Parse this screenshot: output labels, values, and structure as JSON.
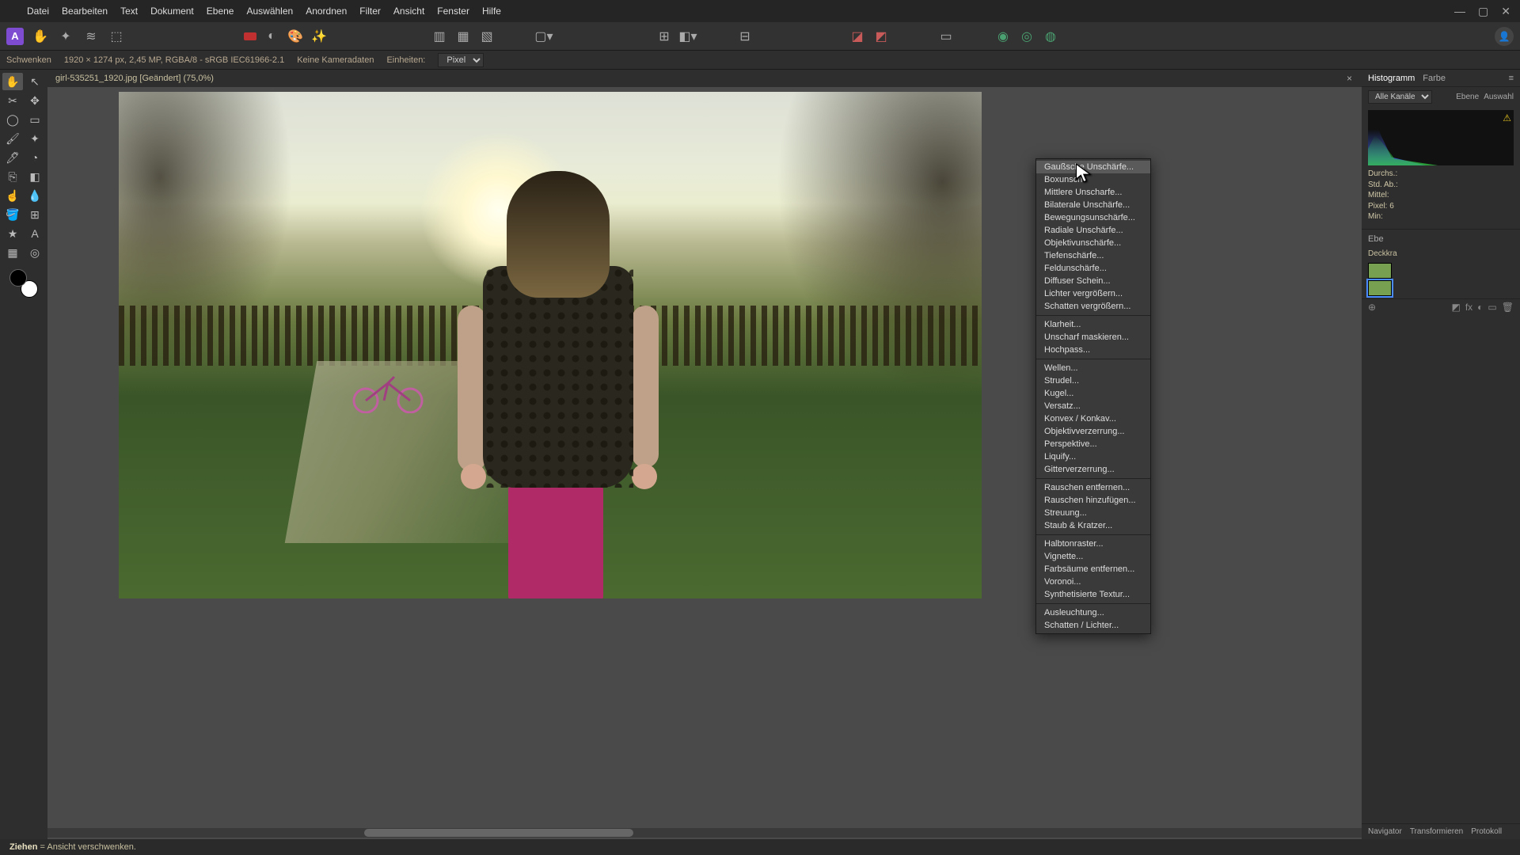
{
  "menu": [
    "Datei",
    "Bearbeiten",
    "Text",
    "Dokument",
    "Ebene",
    "Auswählen",
    "Anordnen",
    "Filter",
    "Ansicht",
    "Fenster",
    "Hilfe"
  ],
  "contextbar": {
    "tool": "Schwenken",
    "docinfo": "1920 × 1274 px, 2,45 MP, RGBA/8 - sRGB IEC61966-2.1",
    "camera": "Keine Kameradaten",
    "units_label": "Einheiten:",
    "units_value": "Pixel"
  },
  "doc_tab": "girl-535251_1920.jpg [Geändert] (75,0%)",
  "rightpanel": {
    "tabs": [
      "Histogramm",
      "Farbe"
    ],
    "channel": "Alle Kanäle",
    "btn_layer": "Ebene",
    "btn_sel": "Auswahl",
    "stats": {
      "l1": "Durchs.:",
      "l2": "Std. Ab.:",
      "l3": "Mittel:",
      "l4": "Pixel: 6",
      "l5": "Min:"
    },
    "layers_tabs": "Ebe",
    "opacity_label": "Deckkra",
    "bottom_tabs": [
      "Navigator",
      "Transformieren",
      "Protokoll"
    ]
  },
  "filter_menu": {
    "groups": [
      [
        "Gaußsche Unschärfe...",
        "Boxunsch",
        "Mittlere Unscharfe...",
        "Bilaterale Unschärfe...",
        "Bewegungsunschärfe...",
        "Radiale Unschärfe...",
        "Objektivunschärfe...",
        "Tiefenschärfe...",
        "Feldunschärfe...",
        "Diffuser Schein...",
        "Lichter vergrößern...",
        "Schatten vergrößern..."
      ],
      [
        "Klarheit...",
        "Unscharf maskieren...",
        "Hochpass..."
      ],
      [
        "Wellen...",
        "Strudel...",
        "Kugel...",
        "Versatz...",
        "Konvex / Konkav...",
        "Objektivverzerrung...",
        "Perspektive...",
        "Liquify...",
        "Gitterverzerrung..."
      ],
      [
        "Rauschen entfernen...",
        "Rauschen hinzufügen...",
        "Streuung...",
        "Staub & Kratzer..."
      ],
      [
        "Halbtonraster...",
        "Vignette...",
        "Farbsäume entfernen...",
        "Voronoi...",
        "Synthetisierte Textur..."
      ],
      [
        "Ausleuchtung...",
        "Schatten / Lichter..."
      ]
    ],
    "highlighted": 0
  },
  "statusbar": {
    "action": "Ziehen",
    "msg": "= Ansicht verschwenken."
  },
  "tools": [
    "hand",
    "pointer",
    "crop",
    "move",
    "lasso",
    "rect-select",
    "brush",
    "wand",
    "pen",
    "blur",
    "clone",
    "eraser",
    "smudge",
    "drop",
    "bucket",
    "mesh",
    "star",
    "text",
    "grid",
    "picker"
  ]
}
